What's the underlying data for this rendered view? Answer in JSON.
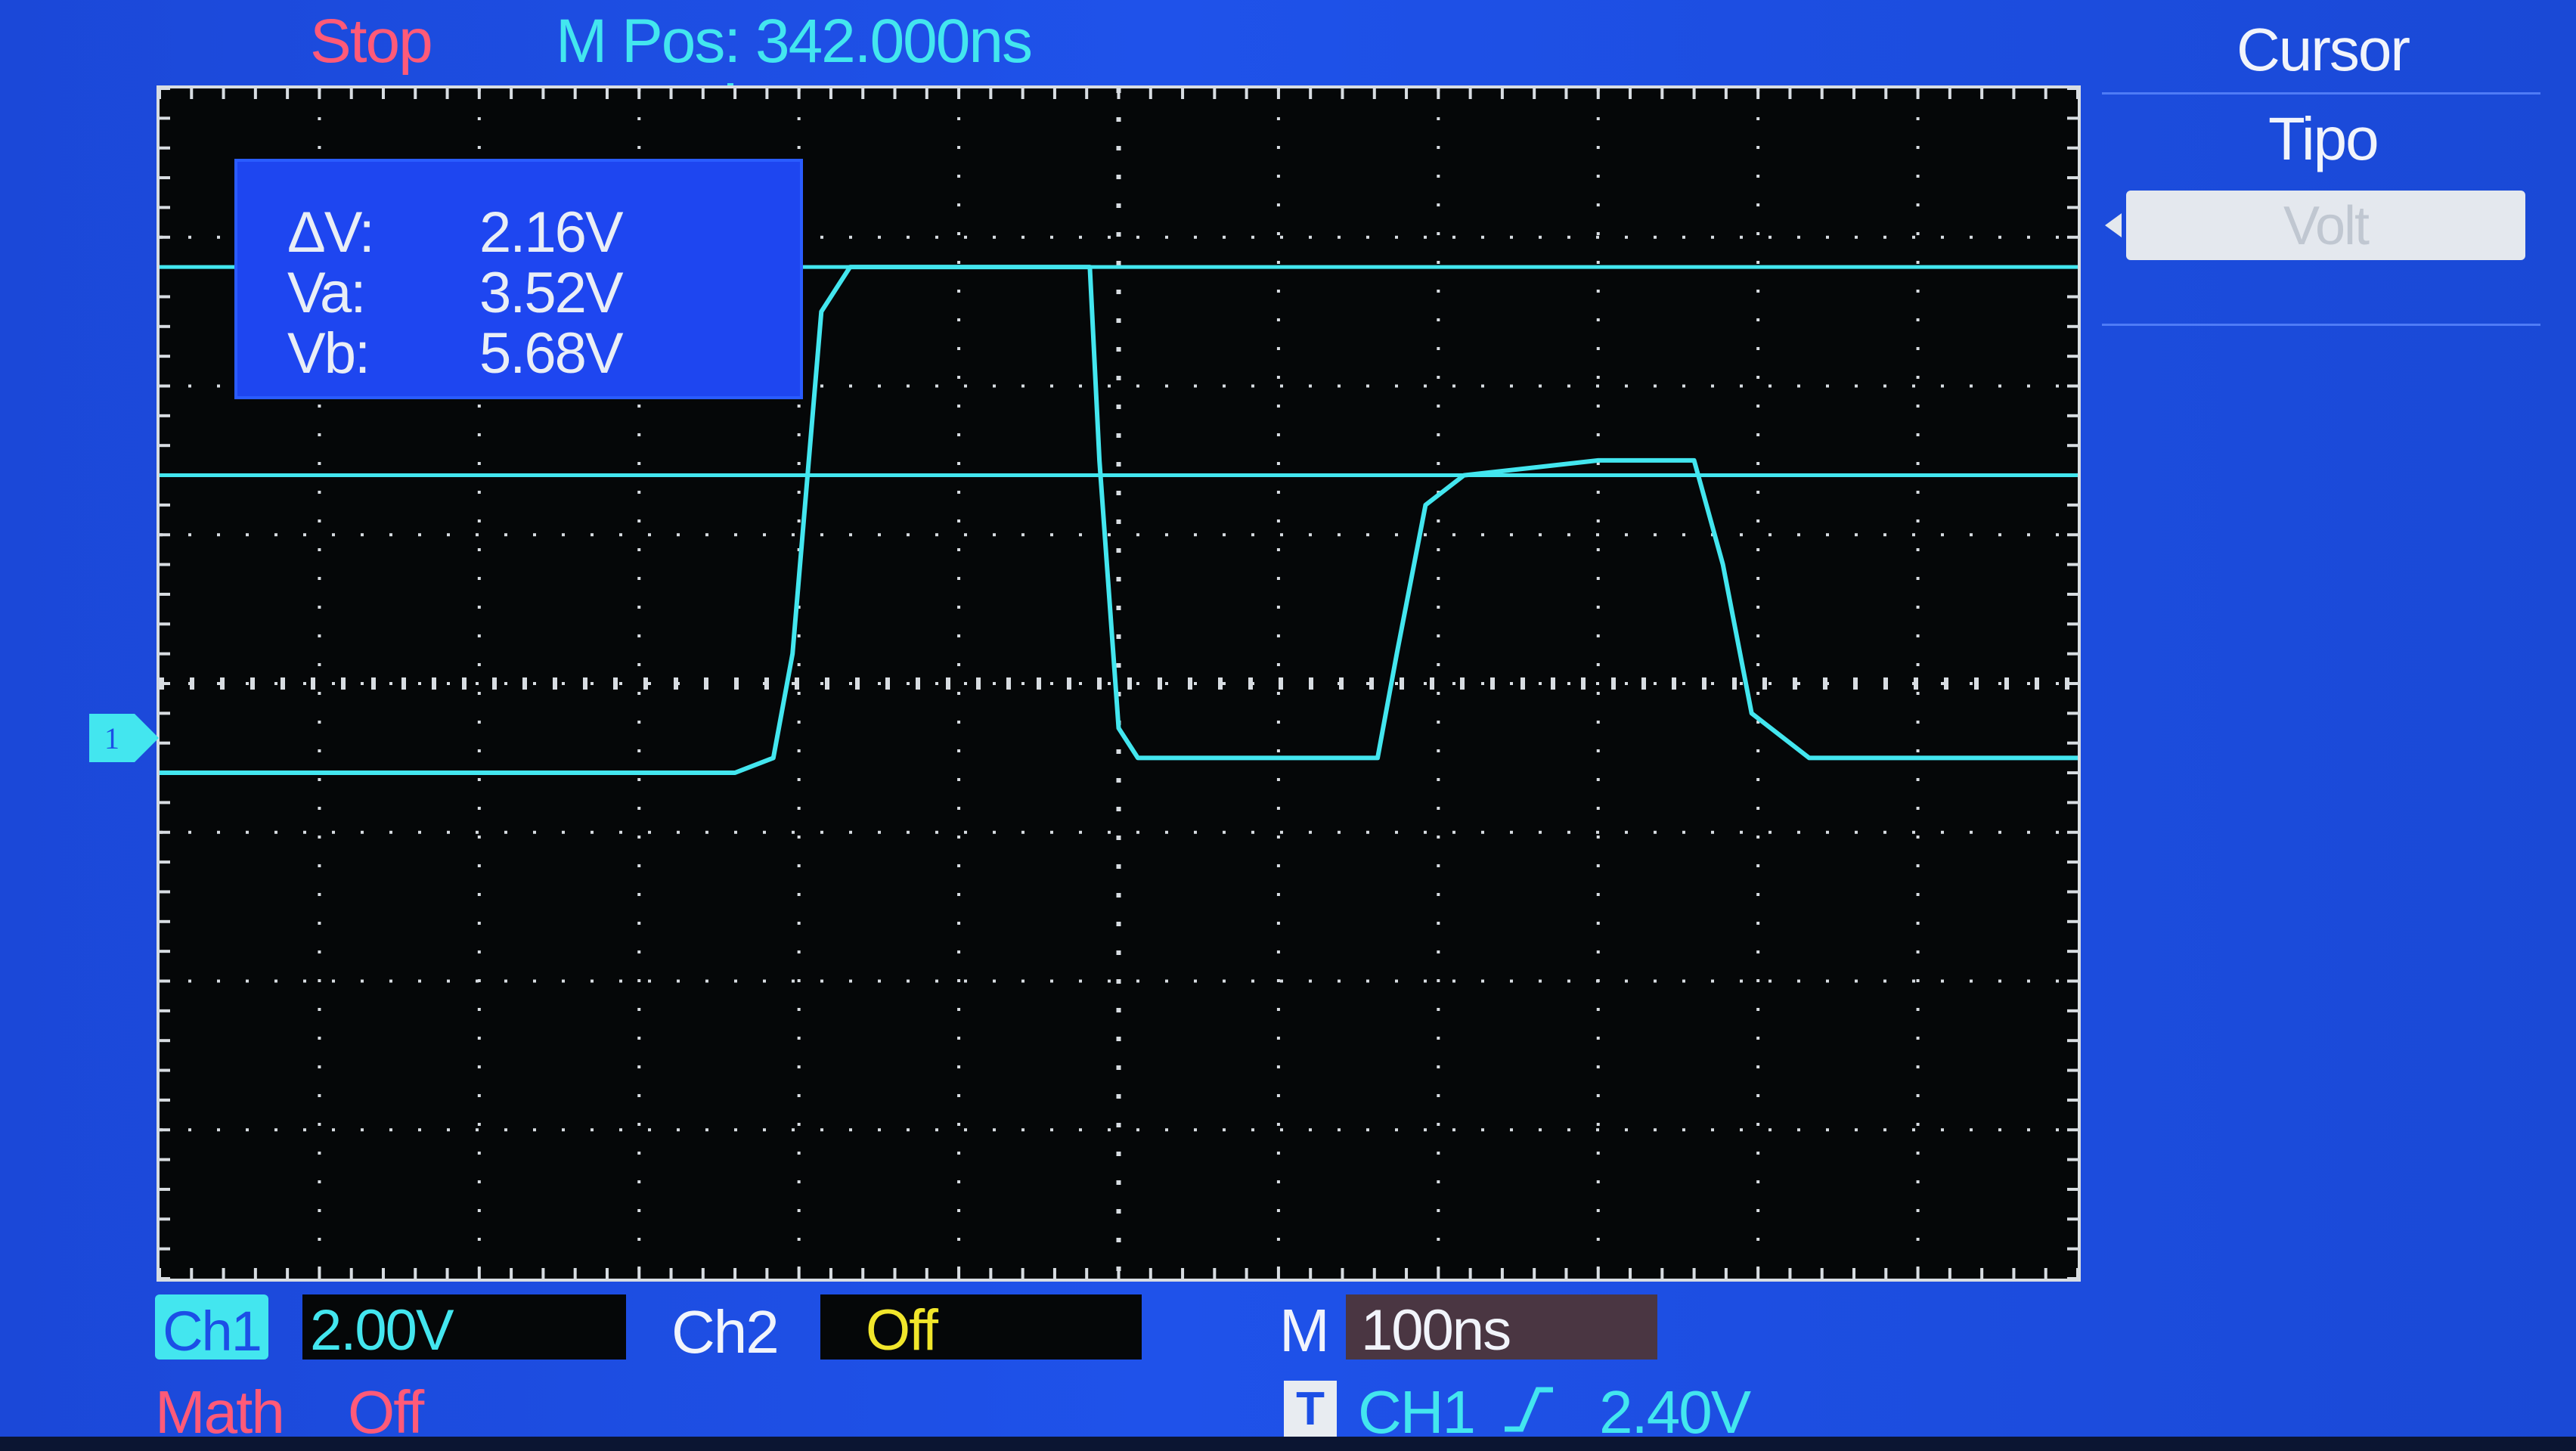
{
  "status": {
    "run_state": "Stop",
    "m_pos_label": "M Pos:",
    "m_pos_value": "342.000ns"
  },
  "cursor_readout": {
    "delta_label": "ΔV:",
    "delta_value": "2.16V",
    "va_label": "Va:",
    "va_value": "3.52V",
    "vb_label": "Vb:",
    "vb_value": "5.68V"
  },
  "side_menu": {
    "title": "Cursor",
    "subtitle": "Tipo",
    "selected_option": "Volt"
  },
  "channels": {
    "ch1_label": "Ch1",
    "ch1_scale": "2.00V",
    "ch2_label": "Ch2",
    "ch2_state": "Off",
    "math_label": "Math",
    "math_state": "Off",
    "ch1_ground_marker": "1"
  },
  "timebase": {
    "label": "M",
    "value": "100ns"
  },
  "trigger": {
    "badge": "T",
    "source": "CH1",
    "slope_icon": "rising-edge-icon",
    "level": "2.40V"
  },
  "colors": {
    "ch1_trace": "#43e6ef",
    "stop_red": "#ff5a78",
    "ch2_yellow": "#f1e62b",
    "screen_blue": "#1f52ea",
    "grid_dots": "#d8dde2"
  },
  "waveform": {
    "channel": "CH1",
    "volts_per_div": 2.0,
    "time_per_div_ns": 100,
    "ground_level_div_from_center": -0.4,
    "points_div": [
      [
        0,
        -0.6
      ],
      [
        3.0,
        -0.6
      ],
      [
        3.2,
        -0.5
      ],
      [
        3.3,
        0.2
      ],
      [
        3.45,
        2.5
      ],
      [
        3.6,
        2.8
      ],
      [
        4.6,
        2.8
      ],
      [
        4.85,
        2.8
      ],
      [
        4.9,
        1.5
      ],
      [
        5.0,
        -0.3
      ],
      [
        5.1,
        -0.5
      ],
      [
        6.0,
        -0.5
      ],
      [
        6.35,
        -0.5
      ],
      [
        6.45,
        0.2
      ],
      [
        6.6,
        1.2
      ],
      [
        6.8,
        1.4
      ],
      [
        7.5,
        1.5
      ],
      [
        8.0,
        1.5
      ],
      [
        8.15,
        0.8
      ],
      [
        8.3,
        -0.2
      ],
      [
        8.6,
        -0.5
      ],
      [
        9.2,
        -0.5
      ],
      [
        10.0,
        -0.5
      ]
    ],
    "cursor_a_div": 1.4,
    "cursor_b_div": 2.8
  }
}
